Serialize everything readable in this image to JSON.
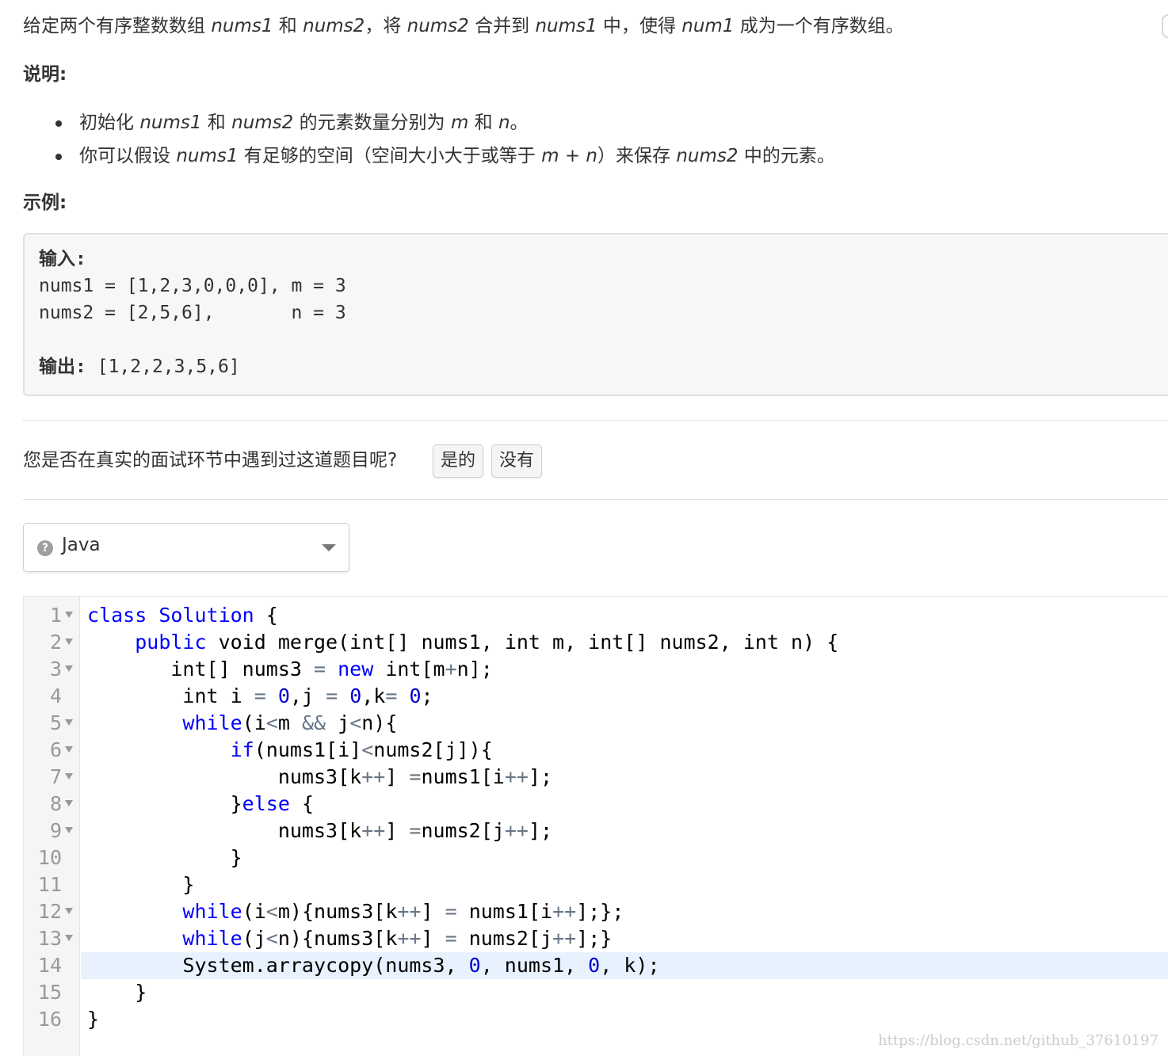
{
  "problem": {
    "intro": [
      {
        "t": "给定两个有序整数数组 "
      },
      {
        "t": "nums1",
        "i": true
      },
      {
        "t": " 和 "
      },
      {
        "t": "nums2",
        "i": true
      },
      {
        "t": "，将 "
      },
      {
        "t": "nums2",
        "i": true
      },
      {
        "t": " 合并到 "
      },
      {
        "t": "nums1",
        "i": true
      },
      {
        "t": " 中"
      },
      {
        "t": "，"
      },
      {
        "t": "使得 "
      },
      {
        "t": "num1",
        "i": true
      },
      {
        "t": " 成为一个有序数组。"
      }
    ],
    "note_heading": "说明:",
    "notes": [
      [
        {
          "t": "初始化 "
        },
        {
          "t": "nums1",
          "i": true
        },
        {
          "t": " 和 "
        },
        {
          "t": "nums2",
          "i": true
        },
        {
          "t": " 的元素数量分别为 "
        },
        {
          "t": "m",
          "i": true
        },
        {
          "t": " 和 "
        },
        {
          "t": "n",
          "i": true
        },
        {
          "t": "。"
        }
      ],
      [
        {
          "t": "你可以假设 "
        },
        {
          "t": "nums1",
          "i": true
        },
        {
          "t": " 有足够的空间（空间大小大于或等于 "
        },
        {
          "t": "m + n",
          "i": true
        },
        {
          "t": "）来保存 "
        },
        {
          "t": "nums2",
          "i": true
        },
        {
          "t": " 中的元素。"
        }
      ]
    ],
    "example_heading": "示例:",
    "example": {
      "input_label": "输入:",
      "line1": "nums1 = [1,2,3,0,0,0], m = 3",
      "line2": "nums2 = [2,5,6],       n = 3",
      "output_label": "输出:",
      "output_value": " [1,2,2,3,5,6]"
    }
  },
  "interview": {
    "question": "您是否在真实的面试环节中遇到过这道题目呢?",
    "yes_label": "是的",
    "no_label": "没有"
  },
  "language_select": {
    "value": "Java",
    "help_glyph": "?"
  },
  "editor": {
    "active_line": 14,
    "lines": [
      {
        "n": "1",
        "fold": true,
        "code": [
          [
            "kw",
            "class"
          ],
          [
            "",
            " "
          ],
          [
            "kw",
            "Solution"
          ],
          [
            "",
            " {"
          ]
        ]
      },
      {
        "n": "2",
        "fold": true,
        "code": [
          [
            "",
            "    "
          ],
          [
            "kw",
            "public"
          ],
          [
            "",
            " void merge(int[] nums1, int m, int[] nums2, int n) {"
          ]
        ]
      },
      {
        "n": "3",
        "fold": true,
        "code": [
          [
            "",
            "       int[] nums3 "
          ],
          [
            "op",
            "="
          ],
          [
            "",
            " "
          ],
          [
            "kw",
            "new"
          ],
          [
            "",
            " int[m"
          ],
          [
            "op",
            "+"
          ],
          [
            "",
            "n];"
          ]
        ]
      },
      {
        "n": "4",
        "fold": false,
        "code": [
          [
            "",
            "        int i "
          ],
          [
            "op",
            "="
          ],
          [
            "",
            " "
          ],
          [
            "num",
            "0"
          ],
          [
            "",
            ",j "
          ],
          [
            "op",
            "="
          ],
          [
            "",
            " "
          ],
          [
            "num",
            "0"
          ],
          [
            "",
            ",k"
          ],
          [
            "op",
            "="
          ],
          [
            "",
            " "
          ],
          [
            "num",
            "0"
          ],
          [
            "",
            ";"
          ]
        ]
      },
      {
        "n": "5",
        "fold": true,
        "code": [
          [
            "",
            "        "
          ],
          [
            "kw",
            "while"
          ],
          [
            "",
            "(i"
          ],
          [
            "op",
            "<"
          ],
          [
            "",
            "m "
          ],
          [
            "op",
            "&&"
          ],
          [
            "",
            " j"
          ],
          [
            "op",
            "<"
          ],
          [
            "",
            "n){"
          ]
        ]
      },
      {
        "n": "6",
        "fold": true,
        "code": [
          [
            "",
            "            "
          ],
          [
            "kw",
            "if"
          ],
          [
            "",
            "(nums1[i]"
          ],
          [
            "op",
            "<"
          ],
          [
            "",
            "nums2[j]){"
          ]
        ]
      },
      {
        "n": "7",
        "fold": true,
        "code": [
          [
            "",
            "                nums3[k"
          ],
          [
            "op",
            "++"
          ],
          [
            "",
            "] "
          ],
          [
            "op",
            "="
          ],
          [
            "",
            "nums1[i"
          ],
          [
            "op",
            "++"
          ],
          [
            "",
            "];"
          ]
        ]
      },
      {
        "n": "8",
        "fold": true,
        "code": [
          [
            "",
            "            }"
          ],
          [
            "kw",
            "else"
          ],
          [
            "",
            " {"
          ]
        ]
      },
      {
        "n": "9",
        "fold": true,
        "code": [
          [
            "",
            "                nums3[k"
          ],
          [
            "op",
            "++"
          ],
          [
            "",
            "] "
          ],
          [
            "op",
            "="
          ],
          [
            "",
            "nums2[j"
          ],
          [
            "op",
            "++"
          ],
          [
            "",
            "];"
          ]
        ]
      },
      {
        "n": "10",
        "fold": false,
        "code": [
          [
            "",
            "            }"
          ]
        ]
      },
      {
        "n": "11",
        "fold": false,
        "code": [
          [
            "",
            "        }"
          ]
        ]
      },
      {
        "n": "12",
        "fold": true,
        "code": [
          [
            "",
            "        "
          ],
          [
            "kw",
            "while"
          ],
          [
            "",
            "(i"
          ],
          [
            "op",
            "<"
          ],
          [
            "",
            "m){nums3[k"
          ],
          [
            "op",
            "++"
          ],
          [
            "",
            "] "
          ],
          [
            "op",
            "="
          ],
          [
            "",
            " nums1[i"
          ],
          [
            "op",
            "++"
          ],
          [
            "",
            "];};"
          ]
        ]
      },
      {
        "n": "13",
        "fold": true,
        "code": [
          [
            "",
            "        "
          ],
          [
            "kw",
            "while"
          ],
          [
            "",
            "(j"
          ],
          [
            "op",
            "<"
          ],
          [
            "",
            "n){nums3[k"
          ],
          [
            "op",
            "++"
          ],
          [
            "",
            "] "
          ],
          [
            "op",
            "="
          ],
          [
            "",
            " nums2[j"
          ],
          [
            "op",
            "++"
          ],
          [
            "",
            "];}"
          ]
        ]
      },
      {
        "n": "14",
        "fold": false,
        "code": [
          [
            "",
            "        System.arraycopy(nums3, "
          ],
          [
            "num",
            "0"
          ],
          [
            "",
            ", nums1, "
          ],
          [
            "num",
            "0"
          ],
          [
            "",
            ", k);"
          ]
        ]
      },
      {
        "n": "15",
        "fold": false,
        "code": [
          [
            "",
            "    }"
          ]
        ]
      },
      {
        "n": "16",
        "fold": false,
        "code": [
          [
            "",
            "}"
          ]
        ]
      }
    ]
  },
  "watermark": "https://blog.csdn.net/github_37610197",
  "colors": {
    "keyword": "#0000ff",
    "operator": "#687687",
    "number": "#0000cd",
    "active_line": "#e8f2ff"
  }
}
